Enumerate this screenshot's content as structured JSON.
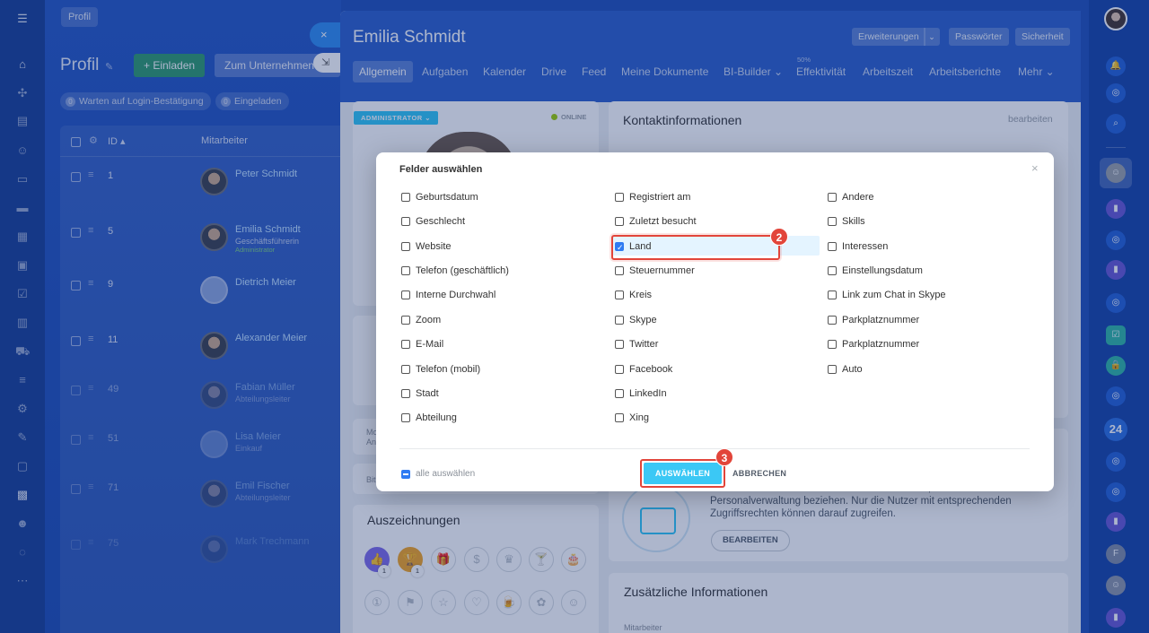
{
  "bg": {
    "profil_tab": "Profil",
    "title": "Profil",
    "invite_btn": "+ Einladen",
    "company_btn": "Zum Unternehmen hinzufügen",
    "chip1_count": "0",
    "chip1_label": "Warten auf Login-Bestätigung",
    "chip2_count": "0",
    "chip2_label": "Eingeladen",
    "col_id": "ID ▴",
    "col_emp": "Mitarbeiter",
    "rows": [
      {
        "id": "1",
        "name": "Peter Schmidt",
        "pos": "",
        "pos2": ""
      },
      {
        "id": "5",
        "name": "Emilia Schmidt",
        "pos": "Geschäftsführerin",
        "pos2": "Administrator"
      },
      {
        "id": "9",
        "name": "Dietrich Meier",
        "pos": "",
        "pos2": ""
      },
      {
        "id": "11",
        "name": "Alexander Meier",
        "pos": "",
        "pos2": ""
      },
      {
        "id": "49",
        "name": "Fabian Müller",
        "pos": "Abteilungsleiter",
        "pos2": ""
      },
      {
        "id": "51",
        "name": "Lisa Meier",
        "pos": "Einkauf",
        "pos2": ""
      },
      {
        "id": "71",
        "name": "Emil Fischer",
        "pos": "Abteilungsleiter",
        "pos2": ""
      },
      {
        "id": "75",
        "name": "Mark Trechmann",
        "pos": "",
        "pos2": ""
      }
    ]
  },
  "profile": {
    "name": "Emilia Schmidt",
    "header_buttons": {
      "erweiterungen": "Erweiterungen",
      "passwoerter": "Passwörter",
      "sicherheit": "Sicherheit"
    },
    "tabs": [
      "Allgemein",
      "Aufgaben",
      "Kalender",
      "Drive",
      "Feed",
      "Meine Dokumente",
      "BI-Builder ⌄",
      "Effektivität",
      "Arbeitszeit",
      "Arbeitsberichte",
      "Mehr ⌄"
    ],
    "effektivitaet_pct": "50%",
    "admin_ribbon": "ADMINISTRATOR ⌄",
    "online": "ONLINE",
    "contact_title": "Kontaktinformationen",
    "contact_edit": "bearbeiten",
    "personal_text": "Dieser Bereich enthält Informationen und Daten, die sich auf die Personalverwaltung beziehen. Nur die Nutzer mit entsprechenden Zugriffsrechten können darauf zugreifen.",
    "bearbeiten_btn": "BEARBEITEN",
    "awards_title": "Auszeichnungen",
    "zusatz_title": "Zusätzliche Informationen",
    "mitarbeiter_label": "Mitarbeiter",
    "misc": {
      "mo": "Mo",
      "an": "An",
      "bit": "Bit"
    },
    "badge_counts": [
      "1",
      "1"
    ]
  },
  "modal": {
    "title": "Felder auswählen",
    "close": "×",
    "columns": [
      [
        {
          "label": "Geburtsdatum",
          "checked": false
        },
        {
          "label": "Geschlecht",
          "checked": false
        },
        {
          "label": "Website",
          "checked": false
        },
        {
          "label": "Telefon (geschäftlich)",
          "checked": false
        },
        {
          "label": "Interne Durchwahl",
          "checked": false
        },
        {
          "label": "Zoom",
          "checked": false
        },
        {
          "label": "E-Mail",
          "checked": false
        },
        {
          "label": "Telefon (mobil)",
          "checked": false
        },
        {
          "label": "Stadt",
          "checked": false
        },
        {
          "label": "Abteilung",
          "checked": false
        }
      ],
      [
        {
          "label": "Registriert am",
          "checked": false
        },
        {
          "label": "Zuletzt besucht",
          "checked": false
        },
        {
          "label": "Land",
          "checked": true
        },
        {
          "label": "Steuernummer",
          "checked": false
        },
        {
          "label": "Kreis",
          "checked": false
        },
        {
          "label": "Skype",
          "checked": false
        },
        {
          "label": "Twitter",
          "checked": false
        },
        {
          "label": "Facebook",
          "checked": false
        },
        {
          "label": "LinkedIn",
          "checked": false
        },
        {
          "label": "Xing",
          "checked": false
        }
      ],
      [
        {
          "label": "Andere",
          "checked": false
        },
        {
          "label": "Skills",
          "checked": false
        },
        {
          "label": "Interessen",
          "checked": false
        },
        {
          "label": "Einstellungsdatum",
          "checked": false
        },
        {
          "label": "Link zum Chat in Skype",
          "checked": false
        },
        {
          "label": "Parkplatznummer",
          "checked": false
        },
        {
          "label": "Parkplatznummer",
          "checked": false
        },
        {
          "label": "Auto",
          "checked": false
        }
      ]
    ],
    "select_all": "alle auswählen",
    "select_btn": "AUSWÄHLEN",
    "cancel_btn": "ABBRECHEN",
    "step2": "2",
    "step3": "3"
  },
  "right_rail": {
    "counter": "24"
  },
  "colors": {
    "accent": "#3bc8f5",
    "highlight": "#e2453a",
    "checkbox": "#2f7bf2"
  }
}
